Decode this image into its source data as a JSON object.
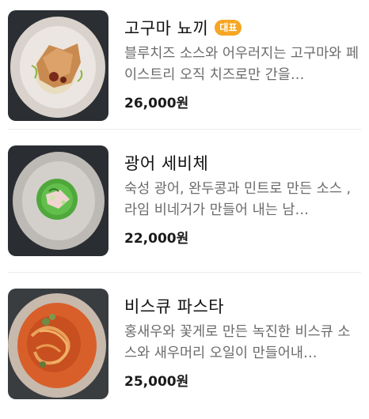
{
  "menu": {
    "items": [
      {
        "name": "고구마 뇨끼",
        "badge": "대표",
        "description": "블루치즈 소스와 어우러지는 고구마와 페이스트리 오직 치즈로만 간을…",
        "price": "26,000원",
        "image_icon": "dish-gnocchi-image"
      },
      {
        "name": "광어 세비체",
        "badge": "",
        "description": "숙성 광어, 완두콩과 민트로 만든 소스 , 라임 비네거가 만들어 내는 남…",
        "price": "22,000원",
        "image_icon": "dish-ceviche-image"
      },
      {
        "name": "비스큐 파스타",
        "badge": "",
        "description": "홍새우와 꽃게로 만든 녹진한 비스큐 소스와 새우머리 오일이 만들어내…",
        "price": "25,000원",
        "image_icon": "dish-pasta-image"
      }
    ]
  }
}
